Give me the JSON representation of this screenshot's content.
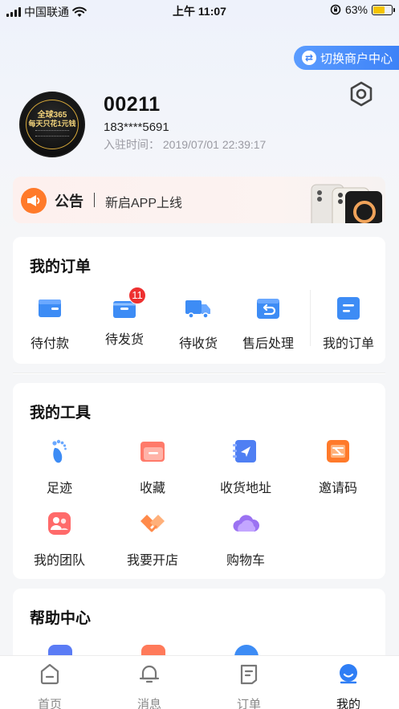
{
  "status_bar": {
    "carrier": "中国联通",
    "time": "上午 11:07",
    "battery_percent": "63%"
  },
  "header": {
    "switch_merchant_label": "切换商户中心"
  },
  "profile": {
    "avatar_text_1": "全球365",
    "avatar_text_2": "每天只花1元钱",
    "user_id": "00211",
    "phone": "183****5691",
    "join_time": "入驻时间：  2019/07/01 22:39:17"
  },
  "notice": {
    "title": "公告",
    "text": "新启APP上线"
  },
  "orders": {
    "title": "我的订单",
    "items": [
      {
        "label": "待付款",
        "icon": "wallet-icon"
      },
      {
        "label": "待发货",
        "icon": "box-icon",
        "badge": "11"
      },
      {
        "label": "待收货",
        "icon": "truck-icon"
      },
      {
        "label": "售后处理",
        "icon": "return-icon"
      },
      {
        "label": "我的订单",
        "icon": "order-list-icon"
      }
    ]
  },
  "tools": {
    "title": "我的工具",
    "items": [
      {
        "label": "足迹",
        "icon": "footprint-icon"
      },
      {
        "label": "收藏",
        "icon": "folder-icon"
      },
      {
        "label": "收货地址",
        "icon": "address-icon"
      },
      {
        "label": "邀请码",
        "icon": "invite-code-icon"
      },
      {
        "label": "我的团队",
        "icon": "team-icon"
      },
      {
        "label": "我要开店",
        "icon": "handshake-icon"
      },
      {
        "label": "购物车",
        "icon": "cloud-cart-icon"
      }
    ]
  },
  "help": {
    "title": "帮助中心"
  },
  "tabbar": {
    "items": [
      {
        "label": "首页",
        "icon": "home-icon"
      },
      {
        "label": "消息",
        "icon": "bell-icon"
      },
      {
        "label": "订单",
        "icon": "order-icon"
      },
      {
        "label": "我的",
        "icon": "profile-icon",
        "active": true
      }
    ]
  },
  "colors": {
    "accent": "#3d82f7",
    "badge": "#ee3030",
    "notice_bg": "#fdf0ee"
  }
}
